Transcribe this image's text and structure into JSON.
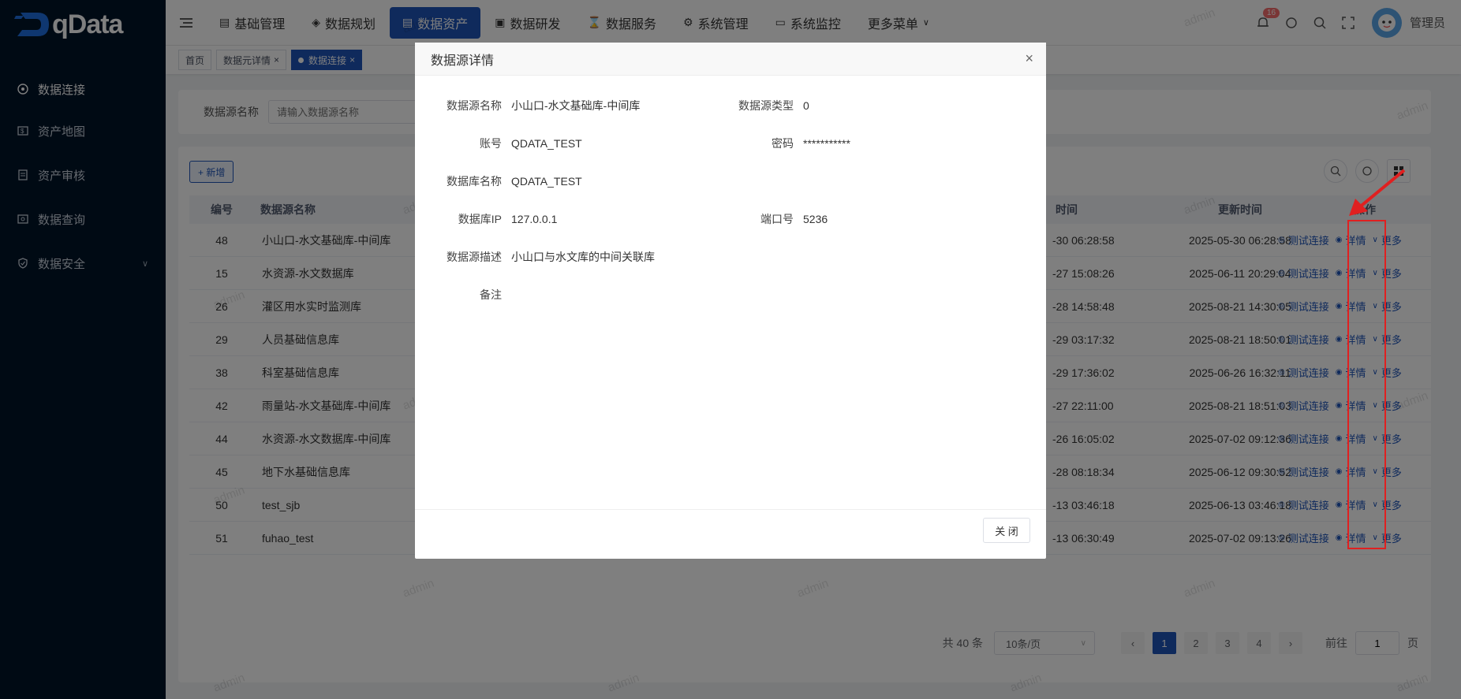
{
  "brand": {
    "name": "qData"
  },
  "sidebar": {
    "items": [
      {
        "label": "数据连接",
        "icon": "target-icon"
      },
      {
        "label": "资产地图",
        "icon": "map-icon"
      },
      {
        "label": "资产审核",
        "icon": "audit-icon"
      },
      {
        "label": "数据查询",
        "icon": "query-icon"
      },
      {
        "label": "数据安全",
        "icon": "shield-icon"
      }
    ]
  },
  "topnav": {
    "items": [
      {
        "label": "基础管理"
      },
      {
        "label": "数据规划"
      },
      {
        "label": "数据资产"
      },
      {
        "label": "数据研发"
      },
      {
        "label": "数据服务"
      },
      {
        "label": "系统管理"
      },
      {
        "label": "系统监控"
      },
      {
        "label": "更多菜单"
      }
    ],
    "badge": "16",
    "username": "管理员"
  },
  "tabs": [
    {
      "label": "首页"
    },
    {
      "label": "数据元详情"
    },
    {
      "label": "数据连接"
    }
  ],
  "search": {
    "label": "数据源名称",
    "placeholder": "请输入数据源名称"
  },
  "toolbar": {
    "add_label": "+ 新增"
  },
  "table": {
    "headers": {
      "id": "编号",
      "name": "数据源名称",
      "ctime": "时间",
      "utime": "更新时间",
      "ops": "操作"
    },
    "rows": [
      {
        "id": "48",
        "name": "小山口-水文基础库-中间库",
        "ctime": "-30 06:28:58",
        "utime": "2025-05-30 06:28:58"
      },
      {
        "id": "15",
        "name": "水资源-水文数据库",
        "ctime": "-27 15:08:26",
        "utime": "2025-06-11 20:29:04"
      },
      {
        "id": "26",
        "name": "灌区用水实时监测库",
        "ctime": "-28 14:58:48",
        "utime": "2025-08-21 14:30:05"
      },
      {
        "id": "29",
        "name": "人员基础信息库",
        "ctime": "-29 03:17:32",
        "utime": "2025-08-21 18:50:01"
      },
      {
        "id": "38",
        "name": "科室基础信息库",
        "ctime": "-29 17:36:02",
        "utime": "2025-06-26 16:32:11"
      },
      {
        "id": "42",
        "name": "雨量站-水文基础库-中间库",
        "ctime": "-27 22:11:00",
        "utime": "2025-08-21 18:51:03"
      },
      {
        "id": "44",
        "name": "水资源-水文数据库-中间库",
        "ctime": "-26 16:05:02",
        "utime": "2025-07-02 09:12:36"
      },
      {
        "id": "45",
        "name": "地下水基础信息库",
        "ctime": "-28 08:18:34",
        "utime": "2025-06-12 09:30:52"
      },
      {
        "id": "50",
        "name": "test_sjb",
        "ctime": "-13 03:46:18",
        "utime": "2025-06-13 03:46:18"
      },
      {
        "id": "51",
        "name": "fuhao_test",
        "ctime": "-13 06:30:49",
        "utime": "2025-07-02 09:13:26"
      }
    ],
    "ops": {
      "test": "测试连接",
      "detail": "详情",
      "more": "更多"
    }
  },
  "pagination": {
    "total": "共 40 条",
    "page_size": "10条/页",
    "pages": [
      "1",
      "2",
      "3",
      "4"
    ],
    "goto_label": "前往",
    "goto_value": "1",
    "page_suffix": "页"
  },
  "watermark": "admin",
  "modal": {
    "title": "数据源详情",
    "fields": {
      "name_label": "数据源名称",
      "name_value": "小山口-水文基础库-中间库",
      "type_label": "数据源类型",
      "type_value": "0",
      "account_label": "账号",
      "account_value": "QDATA_TEST",
      "password_label": "密码",
      "password_value": "***********",
      "db_label": "数据库名称",
      "db_value": "QDATA_TEST",
      "ip_label": "数据库IP",
      "ip_value": "127.0.0.1",
      "port_label": "端口号",
      "port_value": "5236",
      "desc_label": "数据源描述",
      "desc_value": "小山口与水文库的中间关联库",
      "remark_label": "备注",
      "remark_value": ""
    },
    "close_label": "关 闭"
  },
  "colors": {
    "primary": "#1f55b8",
    "sidebar": "#001529",
    "annotation": "#e02020"
  }
}
